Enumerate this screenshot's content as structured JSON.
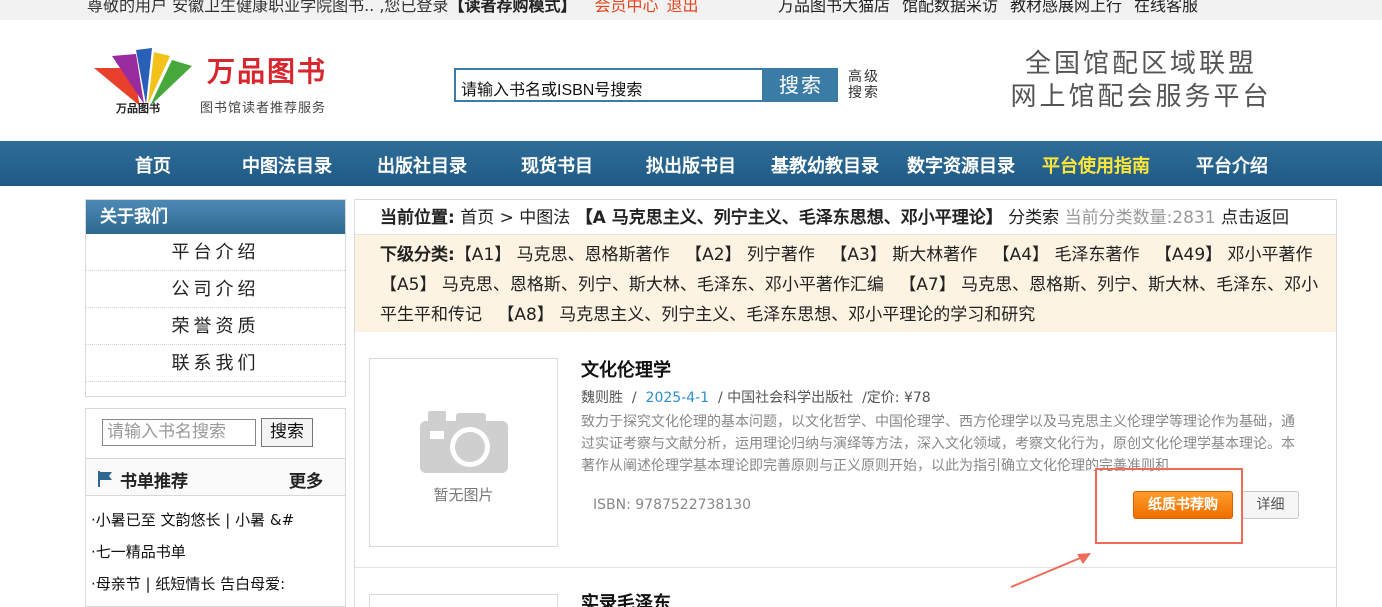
{
  "topbar": {
    "greeting": "尊敬的用户 安徽卫生健康职业学院图书.. ,您已登录",
    "mode": "【读者荐购模式】",
    "member_center": "会员中心",
    "logout": "退出",
    "links": [
      "万品图书大猫店",
      "馆配数据采访",
      "教材感展网上行",
      "在线客服"
    ]
  },
  "header": {
    "logo_name": "万品图书",
    "logo_mini": "万品图书",
    "logo_sub": "图书馆读者推荐服务",
    "search_placeholder": "请输入书名或ISBN号搜索",
    "search_button": "搜索",
    "advanced": "高级搜索",
    "slogan_line1": "全国馆配区域联盟",
    "slogan_line2": "网上馆配会服务平台"
  },
  "nav": {
    "items": [
      "首页",
      "中图法目录",
      "出版社目录",
      "现货书目",
      "拟出版书目",
      "基教幼教目录",
      "数字资源目录",
      "平台使用指南",
      "平台介绍"
    ]
  },
  "sidebar": {
    "about_title": "关于我们",
    "about_items": [
      "平台介绍",
      "公司介绍",
      "荣誉资质",
      "联系我们"
    ],
    "search_placeholder": "请输入书名搜索",
    "search_button": "搜索",
    "rec_title": "书单推荐",
    "rec_more": "更多",
    "rec_items": [
      "·小暑已至 文韵悠长 | 小暑 &#",
      "·七一精品书单",
      "·母亲节 | 纸短情长 告白母爱:"
    ]
  },
  "main": {
    "crumb_label": "当前位置:",
    "crumb_path": "首页 > 中图法",
    "crumb_category": "【A 马克思主义、列宁主义、毛泽东思想、邓小平理论】",
    "crumb_suffix": "分类索",
    "count_label": "当前分类数量:2831",
    "back": "点击返回",
    "subcats_label": "下级分类:",
    "subcats": [
      "【A1】 马克思、恩格斯著作",
      "【A2】 列宁著作",
      "【A3】 斯大林著作",
      "【A4】 毛泽东著作",
      "【A49】 邓小平著作",
      "【A5】 马克思、恩格斯、列宁、斯大林、毛泽东、邓小平著作汇编",
      "【A7】 马克思、恩格斯、列宁、斯大林、毛泽东、邓小平生平和传记",
      "【A8】 马克思主义、列宁主义、毛泽东思想、邓小平理论的学习和研究"
    ]
  },
  "books": [
    {
      "title": "文化伦理学",
      "author": "魏则胜",
      "date": "2025-4-1",
      "publisher": "中国社会科学出版社",
      "price": "/定价: ¥78",
      "description": "致力于探究文化伦理的基本问题，以文化哲学、中国伦理学、西方伦理学以及马克思主义伦理学等理论作为基础，通过实证考察与文献分析，运用理论归纳与演绎等方法，深入文化领域，考察文化行为，原创文化伦理学基本理论。本著作从阐述伦理学基本理论即完善原则与正义原则开始，以此为指引确立文化伦理的完善准则和",
      "isbn": "ISBN: 9787522738130",
      "cover_caption": "暂无图片",
      "buy_button": "纸质书荐购",
      "detail_button": "详细"
    },
    {
      "title": "实录毛泽东"
    }
  ],
  "colors": {
    "nav_bg": "#2a6690",
    "nav_highlight": "#ffe63b",
    "brand_red": "#d8262f",
    "buy_orange": "#f07a10",
    "annotation": "#ef6b5a"
  }
}
